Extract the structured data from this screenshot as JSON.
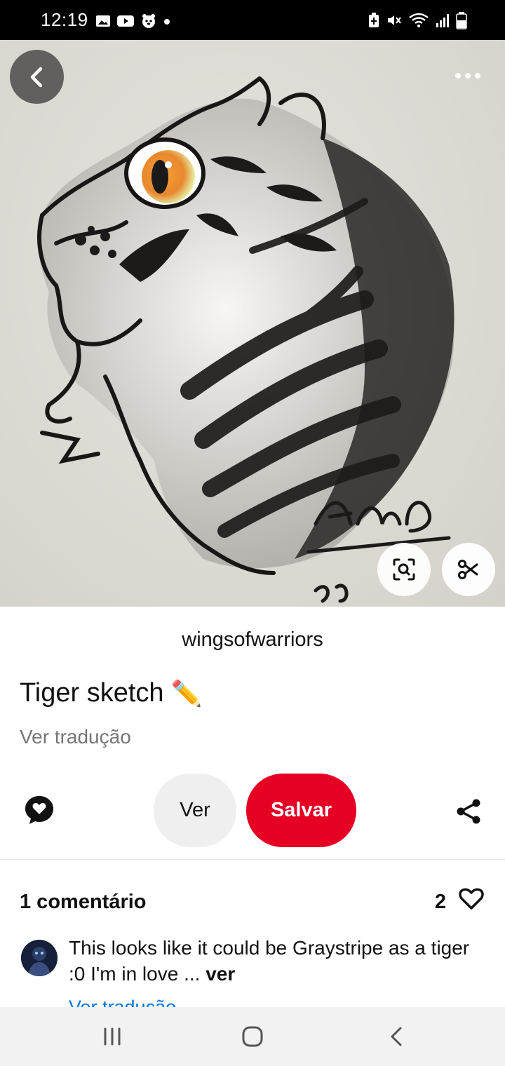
{
  "status_bar": {
    "time": "12:19",
    "left_icons": [
      "image-icon",
      "youtube-icon",
      "pet-icon",
      "dot-icon"
    ],
    "right_icons": [
      "battery-saver-icon",
      "mute-icon",
      "wifi-icon",
      "signal-icon",
      "battery-icon"
    ]
  },
  "image": {
    "description_icons": [
      "back-icon",
      "more-icon",
      "visual-search-icon",
      "scissors-icon"
    ]
  },
  "pin": {
    "author": "wingsofwarriors",
    "title": "Tiger sketch",
    "title_emoji": "✏️",
    "translate_label": "Ver tradução"
  },
  "actions": {
    "view_label": "Ver",
    "save_label": "Salvar"
  },
  "comments": {
    "header": "1 comentário",
    "like_count": "2",
    "items": [
      {
        "text": "This looks like it could be Graystripe as a tiger :0 I'm in love ...",
        "more_label": "ver",
        "translate_label": "Ver tradução"
      }
    ]
  },
  "colors": {
    "accent": "#e60023",
    "link": "#0074e8",
    "muted": "#767676"
  }
}
